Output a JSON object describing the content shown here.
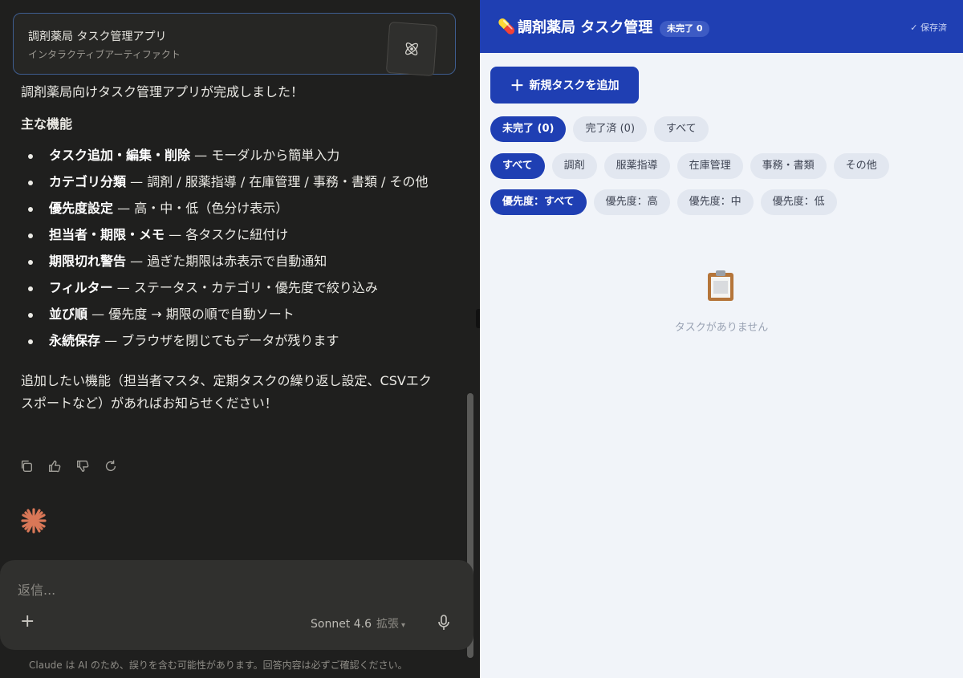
{
  "chat": {
    "artifact": {
      "title": "調剤薬局 タスク管理アプリ",
      "subtitle": "インタラクティブアーティファクト"
    },
    "message": {
      "intro": "調剤薬局向けタスク管理アプリが完成しました！",
      "heading": "主な機能",
      "features": [
        {
          "bold": "タスク追加・編集・削除",
          "text": " — モーダルから簡単入力"
        },
        {
          "bold": "カテゴリ分類",
          "text": " — 調剤 / 服薬指導 / 在庫管理 / 事務・書類 / その他"
        },
        {
          "bold": "優先度設定",
          "text": " — 高・中・低（色分け表示）"
        },
        {
          "bold": "担当者・期限・メモ",
          "text": " — 各タスクに紐付け"
        },
        {
          "bold": "期限切れ警告",
          "text": " — 過ぎた期限は赤表示で自動通知"
        },
        {
          "bold": "フィルター",
          "text": " — ステータス・カテゴリ・優先度で絞り込み"
        },
        {
          "bold": "並び順",
          "text": " — 優先度 → 期限の順で自動ソート"
        },
        {
          "bold": "永続保存",
          "text": " — ブラウザを閉じてもデータが残ります"
        }
      ],
      "outro": "追加したい機能（担当者マスタ、定期タスクの繰り返し設定、CSVエクスポートなど）があればお知らせください！"
    },
    "actions": [
      "copy-icon",
      "thumbs-up-icon",
      "thumbs-down-icon",
      "retry-icon"
    ],
    "composer": {
      "placeholder": "返信...",
      "model": "Sonnet 4.6",
      "mode": "拡張"
    },
    "disclaimer": "Claude は AI のため、誤りを含む可能性があります。回答内容は必ずご確認ください。"
  },
  "app": {
    "title": "調剤薬局 タスク管理",
    "badge": "未完了 0",
    "saved": "✓ 保存済",
    "add_button": "新規タスクを追加",
    "status_filters": [
      {
        "label": "未完了 (0)",
        "active": true
      },
      {
        "label": "完了済 (0)",
        "active": false
      },
      {
        "label": "すべて",
        "active": false
      }
    ],
    "category_filters": [
      {
        "label": "すべて",
        "active": true
      },
      {
        "label": "調剤",
        "active": false
      },
      {
        "label": "服薬指導",
        "active": false
      },
      {
        "label": "在庫管理",
        "active": false
      },
      {
        "label": "事務・書類",
        "active": false
      },
      {
        "label": "その他",
        "active": false
      }
    ],
    "priority_filters": [
      {
        "label": "優先度：すべて",
        "active": true
      },
      {
        "label": "優先度：高",
        "active": false
      },
      {
        "label": "優先度：中",
        "active": false
      },
      {
        "label": "優先度：低",
        "active": false
      }
    ],
    "empty_text": "タスクがありません"
  },
  "colors": {
    "accent": "#1f3fb3",
    "chat_bg": "#1f1f1e",
    "claude_orange": "#d97757"
  }
}
